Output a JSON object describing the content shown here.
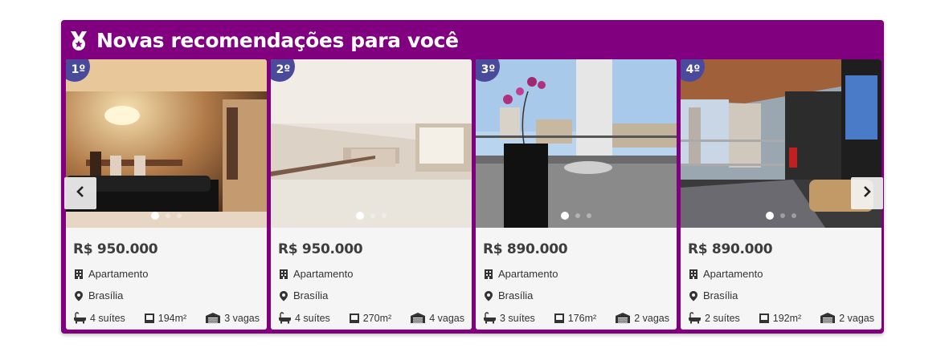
{
  "colors": {
    "panel": "#800080",
    "rank_badge": "#4a4a9c",
    "card_bg": "#f5f5f5"
  },
  "header": {
    "title": "Novas recomendações para você",
    "icon": "medal-icon"
  },
  "nav": {
    "prev_icon": "chevron-left-icon",
    "next_icon": "chevron-right-icon"
  },
  "listings": [
    {
      "rank": "1º",
      "price": "R$ 950.000",
      "type": "Apartamento",
      "city": "Brasília",
      "suites": "4 suítes",
      "area": "194m²",
      "garage": "3 vagas",
      "photo_index": 0,
      "photo_count": 3
    },
    {
      "rank": "2º",
      "price": "R$ 950.000",
      "type": "Apartamento",
      "city": "Brasília",
      "suites": "4 suítes",
      "area": "270m²",
      "garage": "4 vagas",
      "photo_index": 0,
      "photo_count": 3
    },
    {
      "rank": "3º",
      "price": "R$ 890.000",
      "type": "Apartamento",
      "city": "Brasília",
      "suites": "3 suítes",
      "area": "176m²",
      "garage": "2 vagas",
      "photo_index": 0,
      "photo_count": 3
    },
    {
      "rank": "4º",
      "price": "R$ 890.000",
      "type": "Apartamento",
      "city": "Brasília",
      "suites": "2 suítes",
      "area": "192m²",
      "garage": "2 vagas",
      "photo_index": 0,
      "photo_count": 3
    }
  ]
}
